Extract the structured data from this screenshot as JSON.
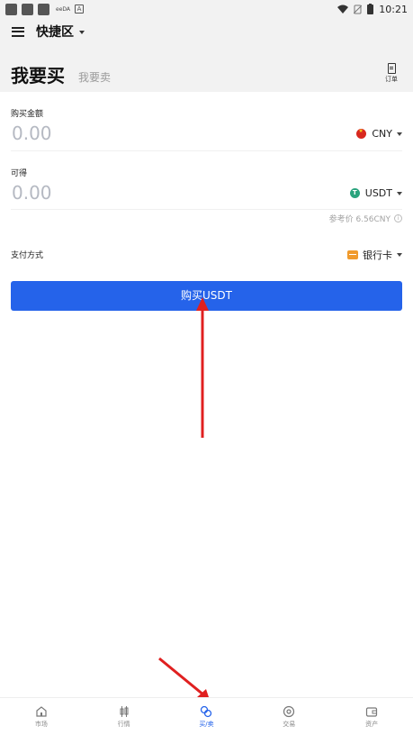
{
  "status_bar": {
    "left_text": "eeDA",
    "badge": "A",
    "time": "10:21"
  },
  "nav": {
    "title": "快捷区"
  },
  "header": {
    "buy_tab": "我要买",
    "sell_tab": "我要卖",
    "orders_label": "订单"
  },
  "buy_form": {
    "amount_label": "购买金额",
    "amount_value": "0.00",
    "amount_currency": "CNY",
    "receive_label": "可得",
    "receive_value": "0.00",
    "receive_currency": "USDT",
    "reference_price": "参考价 6.56CNY",
    "payment_label": "支付方式",
    "payment_value": "银行卡",
    "buy_button": "购买USDT"
  },
  "bottom_nav": [
    {
      "label": "市场",
      "icon": "home-icon",
      "active": false
    },
    {
      "label": "行情",
      "icon": "candlestick-icon",
      "active": false
    },
    {
      "label": "买/卖",
      "icon": "exchange-circles-icon",
      "active": true
    },
    {
      "label": "交易",
      "icon": "trade-icon",
      "active": false
    },
    {
      "label": "资产",
      "icon": "wallet-icon",
      "active": false
    }
  ],
  "colors": {
    "accent": "#2563ea",
    "annotation_arrow": "#e02020"
  }
}
